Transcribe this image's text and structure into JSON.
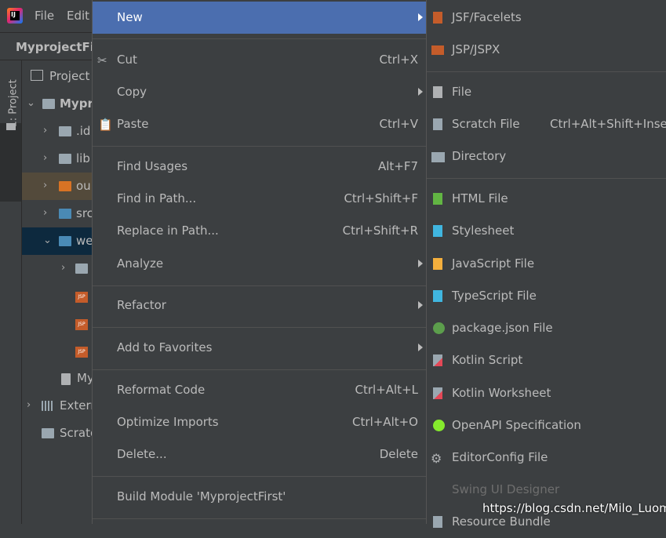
{
  "menubar": {
    "logo": "IJ",
    "file": "File",
    "edit": "Edit"
  },
  "project_title": "MyprojectFir",
  "toolstrip": {
    "label": "1: Project"
  },
  "panel": {
    "header": "Project"
  },
  "tree": [
    {
      "text": "Mypr",
      "arrow": "expanded",
      "icon": "module-folder-icon"
    },
    {
      "text": ".id",
      "arrow": "collapsed",
      "icon": "folder-icon"
    },
    {
      "text": "lib",
      "arrow": "collapsed",
      "icon": "folder-icon"
    },
    {
      "text": "ou",
      "arrow": "collapsed",
      "icon": "excluded-folder-icon"
    },
    {
      "text": "src",
      "arrow": "collapsed",
      "icon": "source-folder-icon"
    },
    {
      "text": "we",
      "arrow": "expanded",
      "icon": "web-folder-icon"
    },
    {
      "text": "",
      "arrow": "collapsed",
      "icon": "folder-icon"
    },
    {
      "text": "",
      "arrow": "",
      "icon": "jsp-file-icon"
    },
    {
      "text": "",
      "arrow": "",
      "icon": "jsp-file-icon"
    },
    {
      "text": "",
      "arrow": "",
      "icon": "jsp-file-icon"
    },
    {
      "text": "My",
      "arrow": "",
      "icon": "iml-file-icon"
    },
    {
      "text": "Extern",
      "arrow": "collapsed",
      "icon": "library-icon"
    },
    {
      "text": "Scrato",
      "arrow": "",
      "icon": "scratches-icon"
    }
  ],
  "context_menu": {
    "new": "New",
    "cut": "Cut",
    "cut_shortcut": "Ctrl+X",
    "copy": "Copy",
    "paste": "Paste",
    "paste_shortcut": "Ctrl+V",
    "find_usages": "Find Usages",
    "find_usages_shortcut": "Alt+F7",
    "find_in_path": "Find in Path...",
    "find_in_path_shortcut": "Ctrl+Shift+F",
    "replace_in_path": "Replace in Path...",
    "replace_in_path_shortcut": "Ctrl+Shift+R",
    "analyze": "Analyze",
    "refactor": "Refactor",
    "add_to_favorites": "Add to Favorites",
    "reformat_code": "Reformat Code",
    "reformat_code_shortcut": "Ctrl+Alt+L",
    "optimize_imports": "Optimize Imports",
    "optimize_imports_shortcut": "Ctrl+Alt+O",
    "delete": "Delete...",
    "delete_shortcut": "Delete",
    "build_module": "Build Module 'MyprojectFirst'"
  },
  "new_submenu": {
    "jsf_facelets": "JSF/Facelets",
    "jsp_jspx": "JSP/JSPX",
    "file": "File",
    "scratch_file": "Scratch File",
    "scratch_file_shortcut": "Ctrl+Alt+Shift+Insert",
    "directory": "Directory",
    "html_file": "HTML File",
    "stylesheet": "Stylesheet",
    "javascript_file": "JavaScript File",
    "typescript_file": "TypeScript File",
    "package_json_file": "package.json File",
    "kotlin_script": "Kotlin Script",
    "kotlin_worksheet": "Kotlin Worksheet",
    "openapi_specification": "OpenAPI Specification",
    "editorconfig_file": "EditorConfig File",
    "swing_ui_designer": "Swing UI Designer",
    "resource_bundle": "Resource Bundle"
  },
  "watermark": "https://blog.csdn.net/Milo_Luom",
  "colors": {
    "highlight": "#4b6eaf",
    "background": "#3c3f41",
    "text": "#bbbbbb",
    "selected_row": "#0d293e",
    "excluded_row": "#534a3b"
  }
}
